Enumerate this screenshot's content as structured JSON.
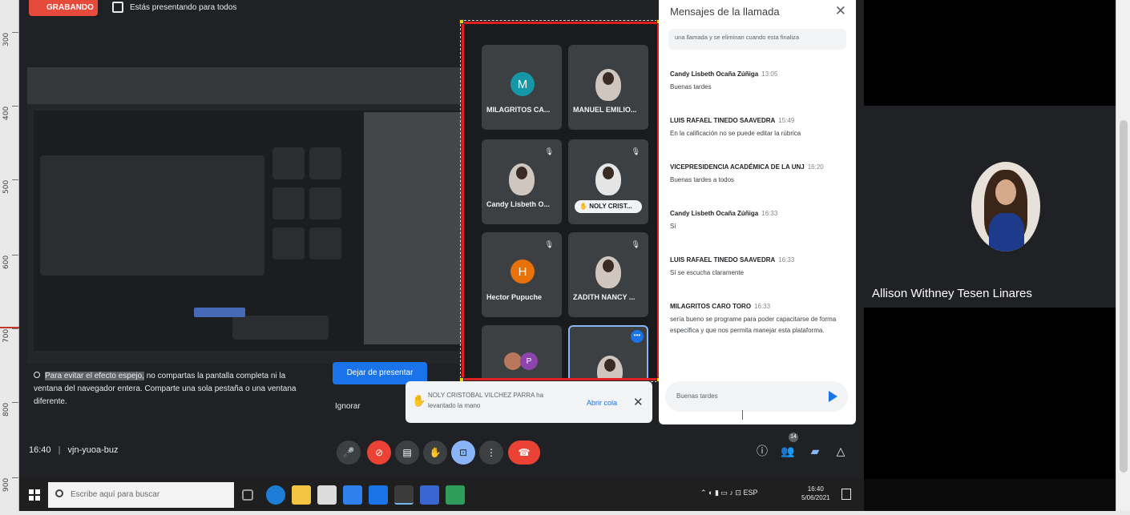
{
  "ruler": {
    "ticks": [
      "300",
      "400",
      "500",
      "600",
      "700",
      "800",
      "900"
    ]
  },
  "recording": {
    "label": "GRABANDO"
  },
  "presenting": {
    "text": "Estás presentando para todos"
  },
  "participants": [
    {
      "name": "MILAGRITOS CA...",
      "initial": "M",
      "color": "#1597a8",
      "kind": "initial"
    },
    {
      "name": "MANUEL EMILIO...",
      "kind": "photo"
    },
    {
      "name": "Candy Lisbeth O...",
      "kind": "photo",
      "mic": "🎙"
    },
    {
      "name": "NOLY CRIST...",
      "kind": "photo",
      "mic": "🎙",
      "hand": true
    },
    {
      "name": "Hector Pupuche",
      "initial": "H",
      "color": "#e8710a",
      "kind": "initial",
      "mic": "🎙"
    },
    {
      "name": "ZADITH NANCY ...",
      "kind": "photo",
      "mic": "🎙"
    },
    {
      "name": "",
      "kind": "group"
    },
    {
      "name": "",
      "kind": "photo",
      "active": true
    }
  ],
  "chat": {
    "title": "Mensajes de la llamada",
    "notice": "una llamada y se eliminan cuando esta finaliza",
    "messages": [
      {
        "sender": "Candy Lisbeth Ocaña Zúñiga",
        "time": "13:05",
        "text": "Buenas tardes"
      },
      {
        "sender": "LUIS RAFAEL TINEDO SAAVEDRA",
        "time": "15:49",
        "text": "En la calificación no se puede editar la rúbrica"
      },
      {
        "sender": "VICEPRESIDENCIA ACADÉMICA DE LA UNJ",
        "time": "16:20",
        "text": "Buenas tardes a todos"
      },
      {
        "sender": "Candy Lisbeth Ocaña Zúñiga",
        "time": "16:33",
        "text": "Sí"
      },
      {
        "sender": "LUIS RAFAEL TINEDO SAAVEDRA",
        "time": "16:33",
        "text": "Sí se escucha claramente"
      },
      {
        "sender": "MILAGRITOS CARO TORO",
        "time": "16:33",
        "text": "sería bueno se programe para poder capacitarse de forma específica y que nos permita manejar esta plataforma."
      }
    ],
    "input_text": "Buenas tardes"
  },
  "presenter": {
    "name": "Allison Withney Tesen Linares"
  },
  "mirror_warning": {
    "highlight": "Para evitar el efecto espejo,",
    "text": " no compartas la pantalla completa ni la ventana del navegador entera. Comparte una sola pestaña o una ventana diferente."
  },
  "buttons": {
    "stop_presenting": "Dejar de presentar",
    "ignore": "Ignorar"
  },
  "toast": {
    "text": "NOLY CRISTOBAL VILCHEZ PARRA ha levantado la mano",
    "action": "Abrir cola"
  },
  "meeting": {
    "time": "16:40",
    "code": "vjn-yuoa-buz",
    "participant_count": "14"
  },
  "taskbar": {
    "search_placeholder": "Escribe aquí para buscar",
    "time": "16:40",
    "date": "5/06/2021",
    "lang": "ESP"
  }
}
